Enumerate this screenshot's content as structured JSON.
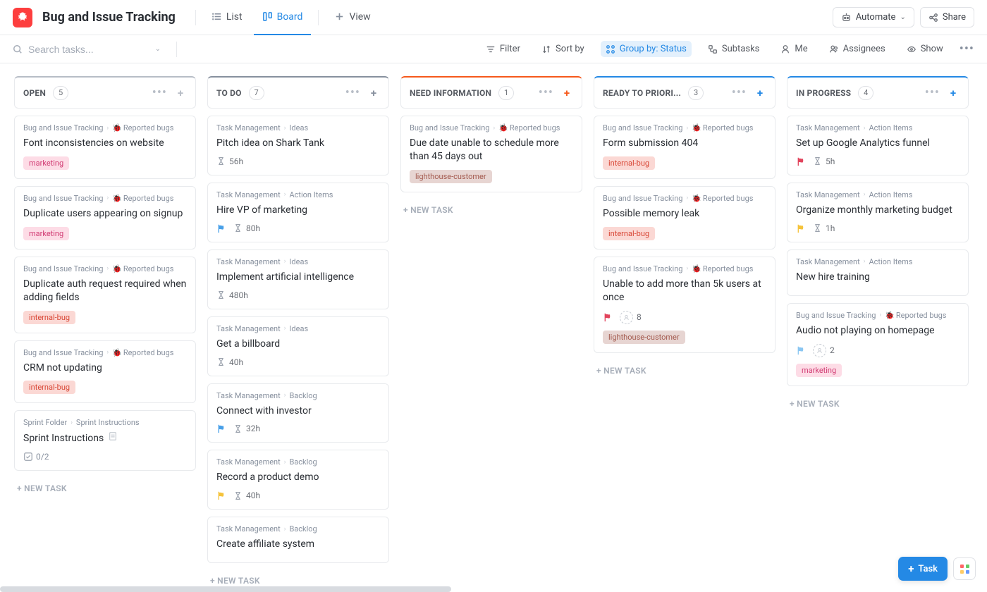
{
  "header": {
    "title": "Bug and Issue Tracking",
    "views": {
      "list": "List",
      "board": "Board",
      "add": "View"
    },
    "automate": "Automate",
    "share": "Share"
  },
  "filterbar": {
    "search_placeholder": "Search tasks...",
    "filter": "Filter",
    "sortby": "Sort by",
    "groupby": "Group by: Status",
    "subtasks": "Subtasks",
    "me": "Me",
    "assignees": "Assignees",
    "show": "Show"
  },
  "columns": [
    {
      "title": "OPEN",
      "count": "5",
      "accent": "#b7bdc6",
      "add_color": "#b7bdc6",
      "cards": [
        {
          "crumbs": [
            "Bug and Issue Tracking",
            "Reported bugs"
          ],
          "bug": true,
          "title": "Font inconsistencies on website",
          "tags": [
            "marketing"
          ]
        },
        {
          "crumbs": [
            "Bug and Issue Tracking",
            "Reported bugs"
          ],
          "bug": true,
          "title": "Duplicate users appearing on signup",
          "tags": [
            "marketing"
          ]
        },
        {
          "crumbs": [
            "Bug and Issue Tracking",
            "Reported bugs"
          ],
          "bug": true,
          "title": "Duplicate auth request required when adding fields",
          "tags": [
            "internal-bug"
          ]
        },
        {
          "crumbs": [
            "Bug and Issue Tracking",
            "Reported bugs"
          ],
          "bug": true,
          "title": "CRM not updating",
          "tags": [
            "internal-bug"
          ]
        },
        {
          "crumbs": [
            "Sprint Folder",
            "Sprint Instructions"
          ],
          "bug": false,
          "title": "Sprint Instructions",
          "doc": true,
          "subtasks": "0/2"
        }
      ]
    },
    {
      "title": "TO DO",
      "count": "7",
      "accent": "#87909e",
      "add_color": "#87909e",
      "cards": [
        {
          "crumbs": [
            "Task Management",
            "Ideas"
          ],
          "title": "Pitch idea on Shark Tank",
          "time": "56h"
        },
        {
          "crumbs": [
            "Task Management",
            "Action Items"
          ],
          "title": "Hire VP of marketing",
          "flag": "blue",
          "time": "80h"
        },
        {
          "crumbs": [
            "Task Management",
            "Ideas"
          ],
          "title": "Implement artificial intelligence",
          "time": "480h"
        },
        {
          "crumbs": [
            "Task Management",
            "Ideas"
          ],
          "title": "Get a billboard",
          "time": "40h"
        },
        {
          "crumbs": [
            "Task Management",
            "Backlog"
          ],
          "title": "Connect with investor",
          "flag": "blue",
          "time": "32h"
        },
        {
          "crumbs": [
            "Task Management",
            "Backlog"
          ],
          "title": "Record a product demo",
          "flag": "yellow",
          "time": "40h"
        },
        {
          "crumbs": [
            "Task Management",
            "Backlog"
          ],
          "title": "Create affiliate system"
        }
      ]
    },
    {
      "title": "NEED INFORMATION",
      "count": "1",
      "accent": "#f6591b",
      "add_color": "#f6591b",
      "cards": [
        {
          "crumbs": [
            "Bug and Issue Tracking",
            "Reported bugs"
          ],
          "bug": true,
          "title": "Due date unable to schedule more than 45 days out",
          "tags": [
            "lighthouse-customer"
          ]
        }
      ]
    },
    {
      "title": "READY TO PRIORI...",
      "count": "3",
      "accent": "#2489e5",
      "add_color": "#2489e5",
      "cards": [
        {
          "crumbs": [
            "Bug and Issue Tracking",
            "Reported bugs"
          ],
          "bug": true,
          "title": "Form submission 404",
          "tags": [
            "internal-bug"
          ]
        },
        {
          "crumbs": [
            "Bug and Issue Tracking",
            "Reported bugs"
          ],
          "bug": true,
          "title": "Possible memory leak",
          "tags": [
            "internal-bug"
          ]
        },
        {
          "crumbs": [
            "Bug and Issue Tracking",
            "Reported bugs"
          ],
          "bug": true,
          "title": "Unable to add more than 5k users at once",
          "flag": "red",
          "assignee_count": "8",
          "tags": [
            "lighthouse-customer"
          ]
        }
      ]
    },
    {
      "title": "IN PROGRESS",
      "count": "4",
      "accent": "#2489e5",
      "add_color": "#2489e5",
      "cards": [
        {
          "crumbs": [
            "Task Management",
            "Action Items"
          ],
          "title": "Set up Google Analytics funnel",
          "flag": "red",
          "time": "5h"
        },
        {
          "crumbs": [
            "Task Management",
            "Action Items"
          ],
          "title": "Organize monthly marketing budget",
          "flag": "yellow",
          "time": "1h"
        },
        {
          "crumbs": [
            "Task Management",
            "Action Items"
          ],
          "title": "New hire training"
        },
        {
          "crumbs": [
            "Bug and Issue Tracking",
            "Reported bugs"
          ],
          "bug": true,
          "title": "Audio not playing on homepage",
          "flag": "lblue",
          "assignee_count": "2",
          "tags": [
            "marketing"
          ]
        }
      ]
    }
  ],
  "newtask_label": "+ NEW TASK",
  "fab": {
    "task": "Task"
  }
}
